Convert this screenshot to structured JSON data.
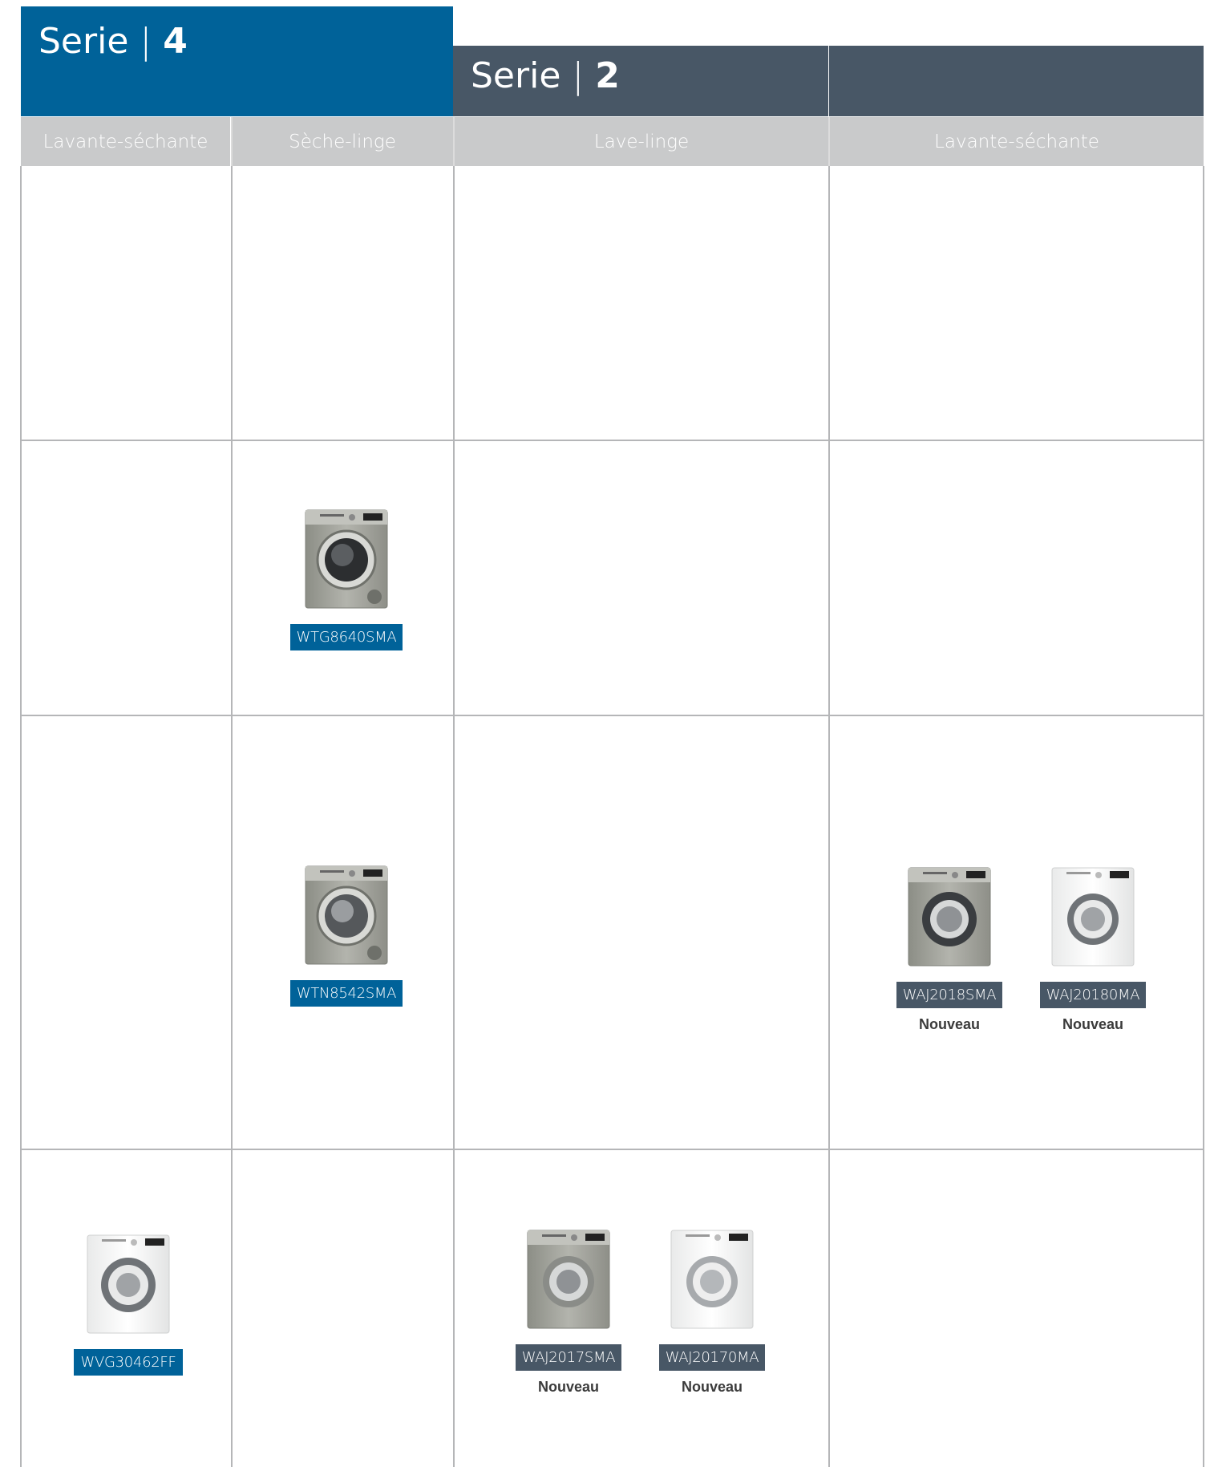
{
  "headers": {
    "serie4": {
      "word": "Serie",
      "sep": "|",
      "num": "4"
    },
    "serie2": {
      "word": "Serie",
      "sep": "|",
      "num": "2"
    }
  },
  "columns": [
    "Lavante-séchante",
    "Sèche-linge",
    "Lave-linge",
    "Lavante-séchante"
  ],
  "products": [
    {
      "code": "WTG8640SMA",
      "finish": "inox"
    },
    {
      "code": "WTN8542SMA",
      "finish": "inox"
    },
    {
      "code": "WAJ2018SMA",
      "finish": "inox",
      "badge": "Nouveau"
    },
    {
      "code": "WAJ20180MA",
      "finish": "white",
      "badge": "Nouveau"
    },
    {
      "code": "WVG30462FF",
      "finish": "white"
    },
    {
      "code": "WAJ2017SMA",
      "finish": "inox",
      "badge": "Nouveau"
    },
    {
      "code": "WAJ20170MA",
      "finish": "white",
      "badge": "Nouveau"
    }
  ],
  "colors": {
    "serie4_blue": "#006299",
    "serie2_slate": "#485766",
    "subheader_grey": "#c9cacb",
    "grid_line": "#b5b6b8"
  }
}
